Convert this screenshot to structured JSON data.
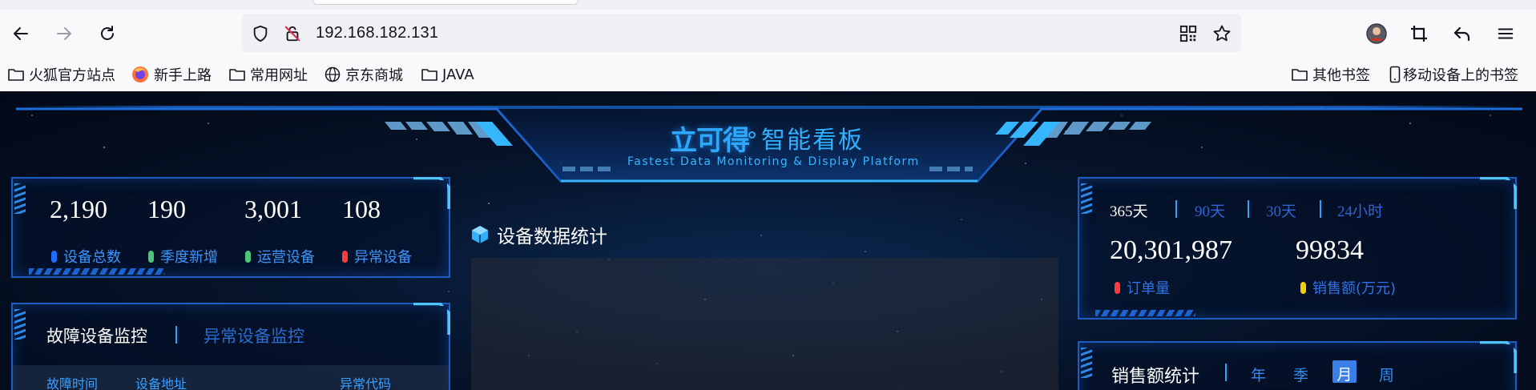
{
  "browser": {
    "url": "192.168.182.131",
    "bookmarks": [
      "火狐官方站点",
      "新手上路",
      "常用网址",
      "京东商城",
      "JAVA"
    ],
    "bookmarks_right": [
      "其他书签",
      "移动设备上的书签"
    ]
  },
  "dashboard": {
    "logo_text": "立可得",
    "title": "智能看板",
    "subtitle": "Fastest Data Monitoring & Display Platform",
    "left_stats": {
      "values": [
        "2,190",
        "190",
        "3,001",
        "108"
      ],
      "labels": [
        "设备总数",
        "季度新增",
        "运营设备",
        "异常设备"
      ],
      "colors": [
        "#1f6cff",
        "#4cc47a",
        "#4cc47a",
        "#ff3b3b"
      ]
    },
    "monitor": {
      "tabs": [
        "故障设备监控",
        "异常设备监控"
      ],
      "columns": [
        "故障时间",
        "设备地址",
        "异常代码"
      ]
    },
    "center": {
      "title": "设备数据统计"
    },
    "orders": {
      "ranges": [
        "365天",
        "90天",
        "30天",
        "24小时"
      ],
      "active_range": 0,
      "values": [
        "20,301,987",
        "99834"
      ],
      "labels": [
        "订单量",
        "销售额(万元)"
      ],
      "colors": [
        "#ff3b3b",
        "#f5d000"
      ]
    },
    "sales": {
      "title": "销售额统计",
      "periods": [
        "年",
        "季",
        "月",
        "周"
      ],
      "active_period": 2
    },
    "accent_color": "#2ea8ff"
  }
}
